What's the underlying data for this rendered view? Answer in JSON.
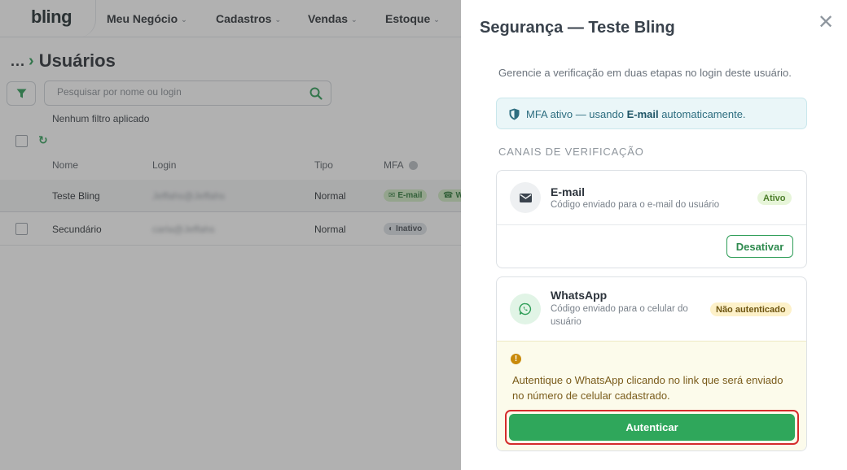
{
  "app": {
    "logo": "bling",
    "nav": [
      {
        "label": "Meu Negócio"
      },
      {
        "label": "Cadastros"
      },
      {
        "label": "Vendas"
      },
      {
        "label": "Estoque"
      }
    ]
  },
  "page": {
    "breadcrumb_dots": "...",
    "title": "Usuários",
    "search_placeholder": "Pesquisar por nome ou login",
    "filter_status": "Nenhum filtro aplicado"
  },
  "table": {
    "columns": {
      "nome": "Nome",
      "login": "Login",
      "tipo": "Tipo",
      "mfa": "MFA"
    },
    "rows": [
      {
        "nome": "Teste Bling",
        "login": "Jeffahs@Jeffahs",
        "tipo": "Normal",
        "mfa": "E-mail",
        "mfa2": "W"
      },
      {
        "nome": "Secundário",
        "login": "carla@Jeffahs",
        "tipo": "Normal",
        "mfa": "Inativo"
      }
    ]
  },
  "drawer": {
    "title": "Segurança — Teste Bling",
    "close": "✕",
    "subtitle": "Gerencie a verificação em duas etapas no login deste usuário.",
    "info_prefix": "MFA ativo — usando ",
    "info_bold": "E-mail",
    "info_suffix": " automaticamente.",
    "section_label": "CANAIS DE VERIFICAÇÃO",
    "email": {
      "name": "E-mail",
      "desc": "Código enviado para o e-mail do usuário",
      "badge": "Ativo",
      "button": "Desativar"
    },
    "whatsapp": {
      "name": "WhatsApp",
      "desc_line1": "Código enviado para o celular do",
      "desc_line2": "usuário",
      "badge": "Não autenticado",
      "warning": "Autentique o WhatsApp clicando no link que será enviado no número de celular cadastrado.",
      "button": "Autenticar"
    }
  },
  "colors": {
    "brand_green": "#2fa75b",
    "info_bg": "#eaf6f8",
    "warning_bg": "#fcfbeb",
    "focus_red": "#d42b2b"
  }
}
